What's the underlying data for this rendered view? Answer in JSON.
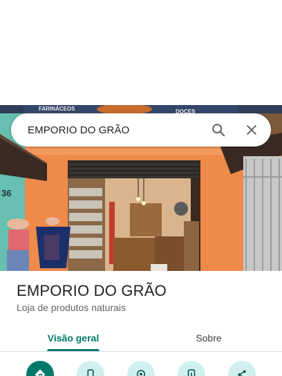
{
  "search": {
    "query": "EMPORIO DO GRÃO",
    "search_icon": "search-icon",
    "clear_icon": "close-icon"
  },
  "photo": {
    "sign_left": "FARINÁCEOS",
    "sign_right": "DOCES",
    "wall_number": "36"
  },
  "place": {
    "name": "EMPORIO DO GRÃO",
    "category": "Loja de produtos naturais"
  },
  "tabs": [
    {
      "label": "Visão geral",
      "active": true
    },
    {
      "label": "Sobre",
      "active": false
    }
  ],
  "actions": [
    {
      "icon": "directions-icon"
    },
    {
      "icon": "phone-icon"
    },
    {
      "icon": "save-location-icon"
    },
    {
      "icon": "send-to-phone-icon"
    },
    {
      "icon": "share-icon"
    }
  ],
  "colors": {
    "accent": "#00796b",
    "wall": "#f08a4b",
    "action_bg": "#d0f0ef"
  }
}
